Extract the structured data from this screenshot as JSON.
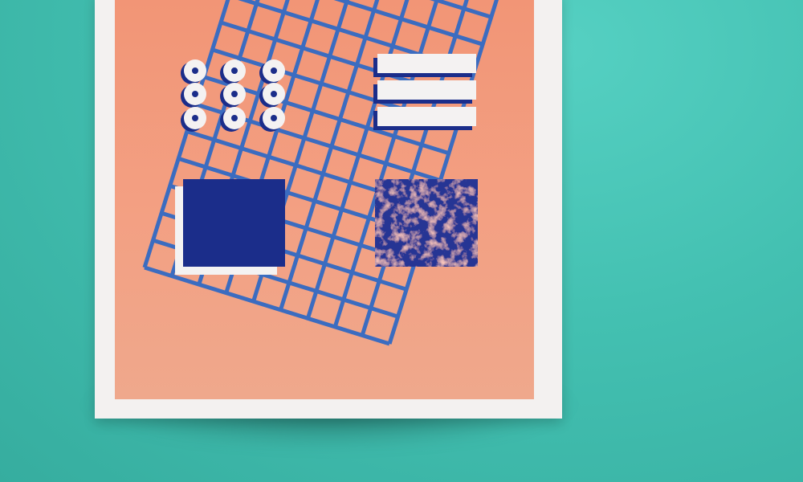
{
  "colors": {
    "background": "#43c0b1",
    "poster_border": "#f3f1f0",
    "poster_fill": "#f29a7b",
    "grid": "#3b6cc0",
    "navy": "#1b2d8a",
    "white": "#f4f2f2"
  },
  "artwork": {
    "grid": {
      "columns": 9,
      "rows": 14,
      "rotation_deg": 17.3
    },
    "dots": {
      "rows": 3,
      "columns": 3
    },
    "bars": 3
  }
}
